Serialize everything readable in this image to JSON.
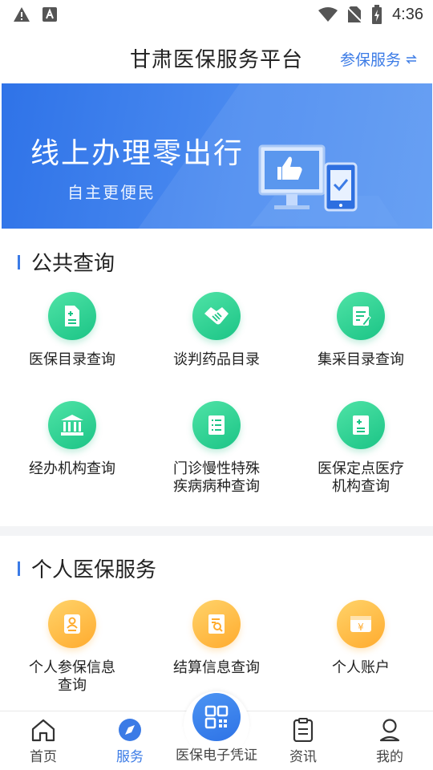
{
  "status_bar": {
    "time": "4:36",
    "icons": [
      "warning-icon",
      "text-a-icon",
      "wifi-icon",
      "no-sim-icon",
      "battery-charging-icon"
    ]
  },
  "header": {
    "title": "甘肃医保服务平台",
    "action_label": "参保服务",
    "action_icon": "swap-icon"
  },
  "banner": {
    "title": "线上办理零出行",
    "subtitle": "自主更便民"
  },
  "public_query": {
    "title": "公共查询",
    "items": [
      {
        "label": "医保目录查询",
        "icon": "document-plus-icon"
      },
      {
        "label": "谈判药品目录",
        "icon": "handshake-icon"
      },
      {
        "label": "集采目录查询",
        "icon": "edit-list-icon"
      },
      {
        "label": "经办机构查询",
        "icon": "institution-icon"
      },
      {
        "label": "门诊慢性特殊疾病病种查询",
        "line1": "门诊慢性特殊",
        "line2": "疾病病种查询",
        "icon": "list-doc-icon"
      },
      {
        "label": "医保定点医疗机构查询",
        "line1": "医保定点医疗",
        "line2": "机构查询",
        "icon": "medical-doc-icon"
      }
    ]
  },
  "personal": {
    "title": "个人医保服务",
    "items": [
      {
        "label": "个人参保信息查询",
        "line1": "个人参保信息",
        "line2": "查询",
        "icon": "person-card-icon"
      },
      {
        "label": "结算信息查询",
        "icon": "search-doc-icon"
      },
      {
        "label": "个人账户",
        "icon": "wallet-icon"
      }
    ]
  },
  "bottom_nav": [
    {
      "label": "首页",
      "icon": "home-icon",
      "active": false
    },
    {
      "label": "服务",
      "icon": "compass-icon",
      "active": true
    },
    {
      "label": "医保电子凭证",
      "icon": "qr-code-icon",
      "active": false
    },
    {
      "label": "资讯",
      "icon": "clipboard-icon",
      "active": false
    },
    {
      "label": "我的",
      "icon": "user-icon",
      "active": false
    }
  ],
  "colors": {
    "accent": "#3b7be6",
    "green": "#1bc486",
    "orange": "#ffab2e"
  }
}
